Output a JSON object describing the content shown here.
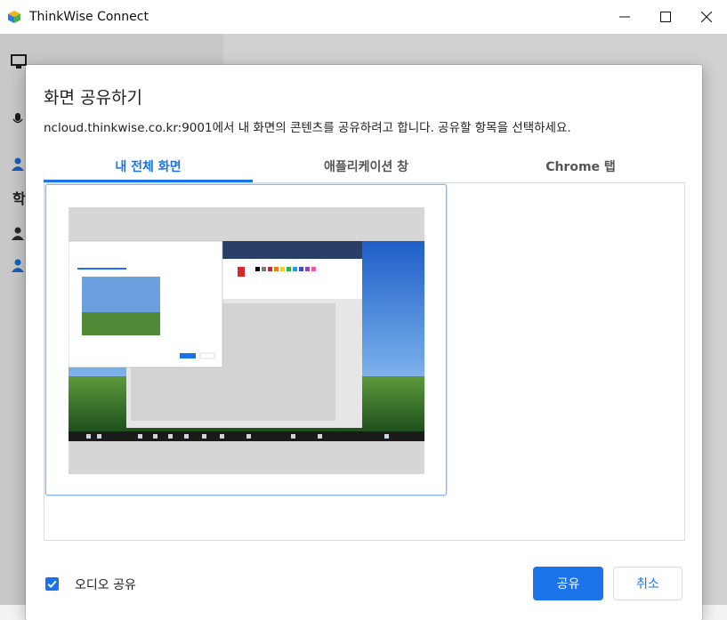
{
  "window": {
    "title": "ThinkWise Connect",
    "icons": [
      "app-cube-icon",
      "minimize-icon",
      "maximize-icon",
      "close-icon"
    ]
  },
  "background_app": {
    "partial_text": "학",
    "icons": [
      "monitor-icon",
      "microphone-icon",
      "user-icon",
      "user-icon",
      "user-icon"
    ]
  },
  "dialog": {
    "title": "화면 공유하기",
    "description": "ncloud.thinkwise.co.kr:9001에서 내 화면의 콘텐츠를 공유하려고 합니다. 공유할 항목을 선택하세요.",
    "tabs": [
      {
        "label": "내 전체 화면",
        "active": true
      },
      {
        "label": "애플리케이션 창",
        "active": false
      },
      {
        "label": "Chrome 탭",
        "active": false
      }
    ],
    "audio_share": {
      "label": "오디오 공유",
      "checked": true
    },
    "buttons": {
      "share": "공유",
      "cancel": "취소"
    }
  },
  "colors": {
    "accent": "#1a73e8",
    "selection_border": "#8ab4f8"
  }
}
